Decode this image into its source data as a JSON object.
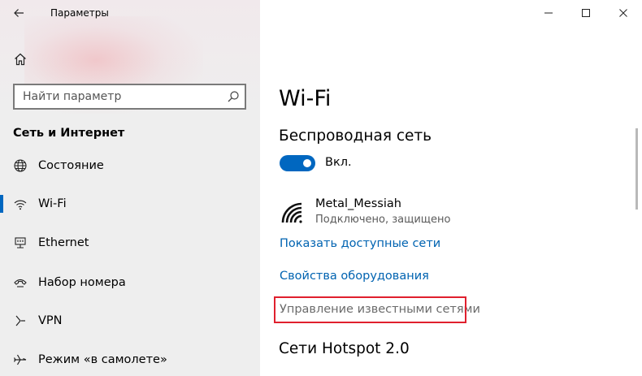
{
  "window": {
    "title": "Параметры"
  },
  "sidebar": {
    "search_placeholder": "Найти параметр",
    "section_header": "Сеть и Интернет",
    "items": [
      {
        "label": "Состояние",
        "icon": "globe-icon",
        "selected": false
      },
      {
        "label": "Wi-Fi",
        "icon": "wifi-icon",
        "selected": true
      },
      {
        "label": "Ethernet",
        "icon": "ethernet-icon",
        "selected": false
      },
      {
        "label": "Набор номера",
        "icon": "phone-icon",
        "selected": false
      },
      {
        "label": "VPN",
        "icon": "vpn-icon",
        "selected": false
      },
      {
        "label": "Режим «в самолете»",
        "icon": "airplane-icon",
        "selected": false
      }
    ]
  },
  "content": {
    "page_title": "Wi-Fi",
    "wireless_title": "Беспроводная сеть",
    "toggle_label": "Вкл.",
    "toggle_on": true,
    "network": {
      "name": "Metal_Messiah",
      "status": "Подключено, защищено"
    },
    "links": {
      "show_networks": "Показать доступные сети",
      "hardware_properties": "Свойства оборудования",
      "manage_known": "Управление известными сетями"
    },
    "hotspot_title": "Сети Hotspot 2.0"
  },
  "colors": {
    "accent": "#0067c0",
    "link": "#0063b1",
    "highlight": "#e0202e"
  }
}
